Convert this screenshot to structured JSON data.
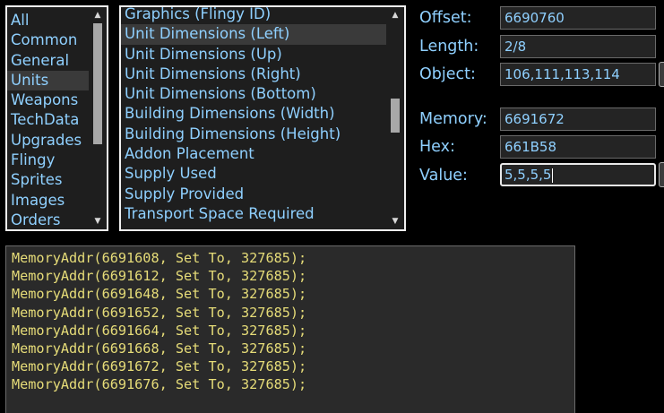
{
  "categories": {
    "items": [
      "All",
      "Common",
      "General",
      "Units",
      "Weapons",
      "TechData",
      "Upgrades",
      "Flingy",
      "Sprites",
      "Images",
      "Orders"
    ],
    "selected": "Units"
  },
  "fields": {
    "items": [
      "Graphics (Flingy ID)",
      "Unit Dimensions (Left)",
      "Unit Dimensions (Up)",
      "Unit Dimensions (Right)",
      "Unit Dimensions (Bottom)",
      "Building Dimensions (Width)",
      "Building Dimensions (Height)",
      "Addon Placement",
      "Supply Used",
      "Supply Provided",
      "Transport Space Required"
    ],
    "selected": "Unit Dimensions (Left)"
  },
  "properties": {
    "offset_label": "Offset:",
    "offset_value": "6690760",
    "length_label": "Length:",
    "length_value": "2/8",
    "object_label": "Object:",
    "object_value": "106,111,113,114",
    "memory_label": "Memory:",
    "memory_value": "6691672",
    "hex_label": "Hex:",
    "hex_value": "661B58",
    "value_label": "Value:",
    "value_value": "5,5,5,5"
  },
  "code": {
    "lines": [
      "MemoryAddr(6691608, Set To, 327685);",
      "MemoryAddr(6691612, Set To, 327685);",
      "MemoryAddr(6691648, Set To, 327685);",
      "MemoryAddr(6691652, Set To, 327685);",
      "MemoryAddr(6691664, Set To, 327685);",
      "MemoryAddr(6691668, Set To, 327685);",
      "MemoryAddr(6691672, Set To, 327685);",
      "MemoryAddr(6691676, Set To, 327685);"
    ]
  },
  "colors": {
    "background": "#000000",
    "list_text": "#8fd0ff",
    "code_text": "#e6dc78",
    "selection": "#3a3a3a"
  },
  "icons": {
    "scroll_up": "triangle-up-icon",
    "scroll_down": "triangle-down-icon"
  }
}
